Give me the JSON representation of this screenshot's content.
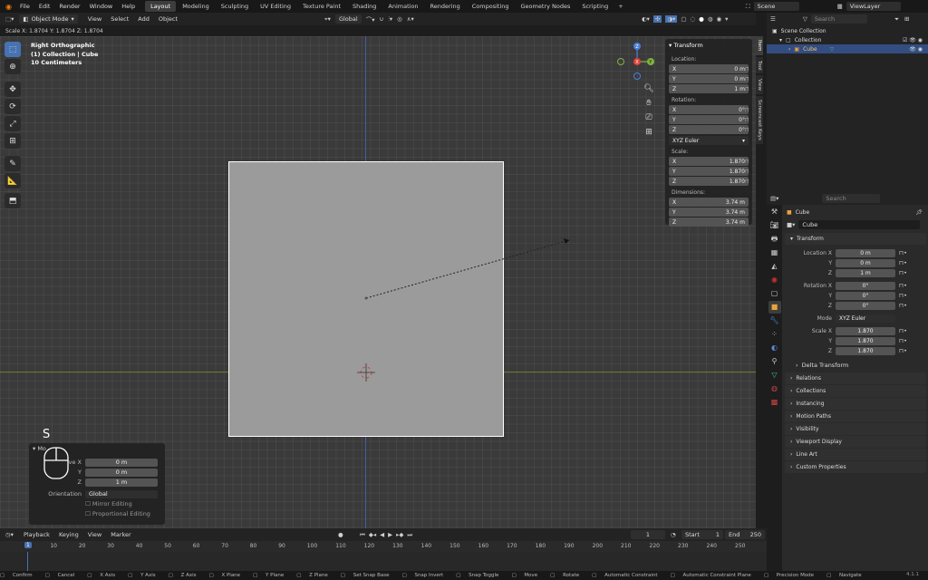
{
  "menu": [
    "File",
    "Edit",
    "Render",
    "Window",
    "Help"
  ],
  "workspaces": [
    "Layout",
    "Modeling",
    "Sculpting",
    "UV Editing",
    "Texture Paint",
    "Shading",
    "Animation",
    "Rendering",
    "Compositing",
    "Geometry Nodes",
    "Scripting"
  ],
  "scene": "Scene",
  "view_layer": "ViewLayer",
  "vpheader": {
    "mode": "Object Mode",
    "items": [
      "View",
      "Select",
      "Add",
      "Object"
    ],
    "orientation": "Global"
  },
  "status_line": "Scale X: 1.8704   Y: 1.8704   Z: 1.8704",
  "overlay": {
    "view": "Right Orthographic",
    "collection": "(1) Collection | Cube",
    "scale": "10 Centimeters"
  },
  "npanel": {
    "title": "Transform",
    "location_label": "Location:",
    "location": [
      [
        "X",
        "0 m"
      ],
      [
        "Y",
        "0 m"
      ],
      [
        "Z",
        "1 m"
      ]
    ],
    "rotation_label": "Rotation:",
    "rotation": [
      [
        "X",
        "0°"
      ],
      [
        "Y",
        "0°"
      ],
      [
        "Z",
        "0°"
      ]
    ],
    "mode": "XYZ Euler",
    "scale_label": "Scale:",
    "scale": [
      [
        "X",
        "1.870"
      ],
      [
        "Y",
        "1.870"
      ],
      [
        "Z",
        "1.870"
      ]
    ],
    "dims_label": "Dimensions:",
    "dims": [
      [
        "X",
        "3.74 m"
      ],
      [
        "Y",
        "3.74 m"
      ],
      [
        "Z",
        "3.74 m"
      ]
    ]
  },
  "ntabs": [
    "Item",
    "Tool",
    "View",
    "Screencast Keys"
  ],
  "key_overlay": "S",
  "op_panel": {
    "rows": [
      [
        "Move X",
        "0 m"
      ],
      [
        "Y",
        "0 m"
      ],
      [
        "Z",
        "1 m"
      ]
    ],
    "orientation_label": "Orientation",
    "orientation": "Global",
    "mirror": "Mirror Editing",
    "prop": "Proportional Editing"
  },
  "timeline": {
    "items": [
      "Playback",
      "Keying",
      "View",
      "Marker"
    ],
    "current": "1",
    "start_label": "Start",
    "start": "1",
    "end_label": "End",
    "end": "250",
    "ticks": [
      "1",
      "10",
      "20",
      "30",
      "40",
      "50",
      "60",
      "70",
      "80",
      "90",
      "100",
      "110",
      "120",
      "130",
      "140",
      "150",
      "160",
      "170",
      "180",
      "190",
      "200",
      "210",
      "220",
      "230",
      "240",
      "250"
    ]
  },
  "statusbar": [
    "Confirm",
    "Cancel",
    "X Axis",
    "Y Axis",
    "Z Axis",
    "X Plane",
    "Y Plane",
    "Z Plane",
    "Set Snap Base",
    "Snap Invert",
    "Snap Toggle",
    "Move",
    "Rotate",
    "Automatic Constraint",
    "Automatic Constraint Plane",
    "Precision Mode",
    "Navigate"
  ],
  "version": "4.1.1",
  "outliner": {
    "search": "Search",
    "scene_collection": "Scene Collection",
    "collection": "Collection",
    "cube": "Cube"
  },
  "props": {
    "search": "Search",
    "object": "Cube",
    "name": "Cube",
    "transform": "Transform",
    "loc": [
      [
        "Location X",
        "0 m"
      ],
      [
        "Y",
        "0 m"
      ],
      [
        "Z",
        "1 m"
      ]
    ],
    "rot": [
      [
        "Rotation X",
        "0°"
      ],
      [
        "Y",
        "0°"
      ],
      [
        "Z",
        "0°"
      ]
    ],
    "mode_label": "Mode",
    "mode": "XYZ Euler",
    "scale": [
      [
        "Scale X",
        "1.870"
      ],
      [
        "Y",
        "1.870"
      ],
      [
        "Z",
        "1.870"
      ]
    ],
    "delta": "Delta Transform",
    "panels": [
      "Relations",
      "Collections",
      "Instancing",
      "Motion Paths",
      "Visibility",
      "Viewport Display",
      "Line Art",
      "Custom Properties"
    ]
  }
}
